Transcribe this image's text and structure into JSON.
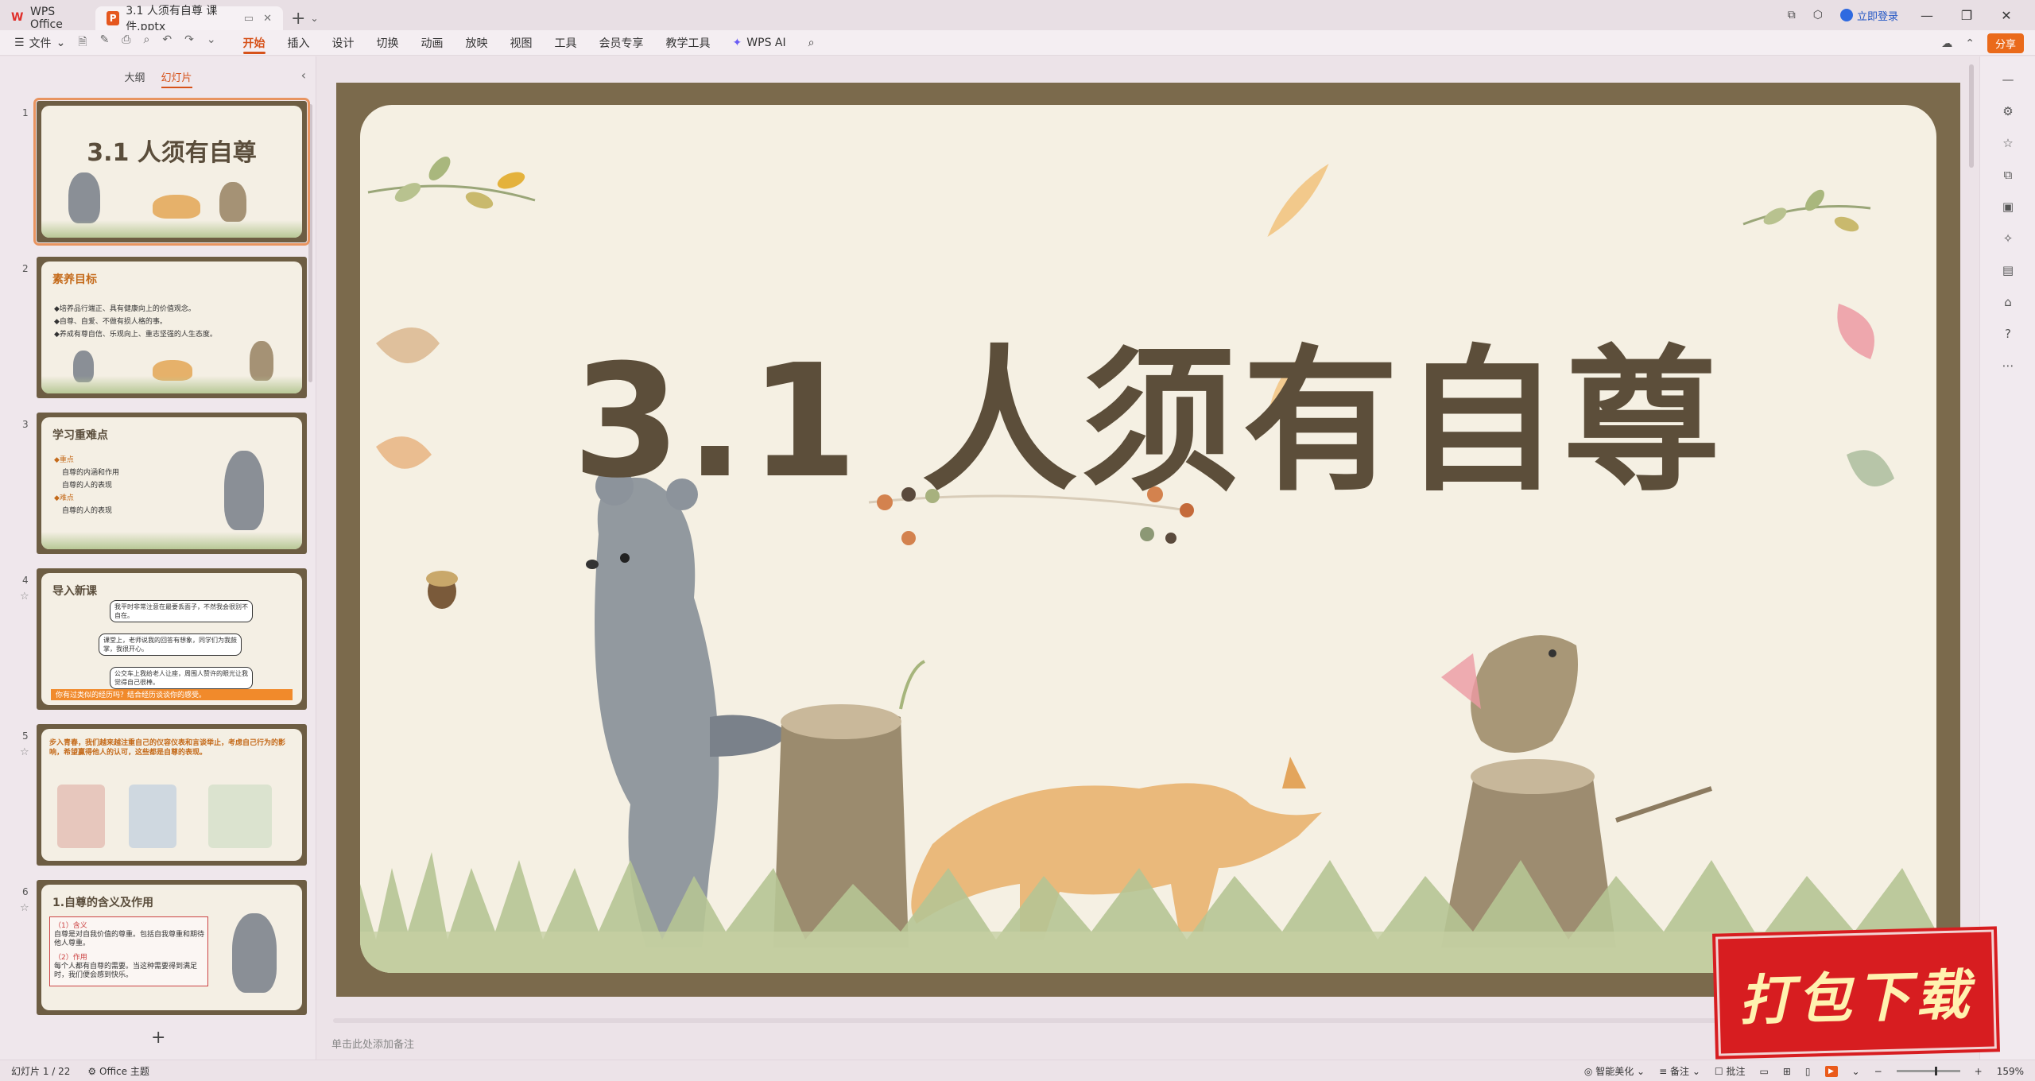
{
  "titlebar": {
    "home_tab": "WPS Office",
    "doc_tab": "3.1 人须有自尊 课件.pptx",
    "login": "立即登录"
  },
  "ribbon": {
    "file": "文件",
    "menu": [
      "开始",
      "插入",
      "设计",
      "切换",
      "动画",
      "放映",
      "视图",
      "工具",
      "会员专享",
      "教学工具"
    ],
    "active_menu": "开始",
    "wps_ai": "WPS AI",
    "share": "分享"
  },
  "left_panel": {
    "tabs": [
      "大纲",
      "幻灯片"
    ],
    "active_tab": "幻灯片",
    "slides": [
      {
        "num": "1",
        "title": "3.1 人须有自尊"
      },
      {
        "num": "2",
        "title": "素养目标",
        "lines": [
          "◆培养品行端正、具有健康向上的价值观念。",
          "◆自尊、自爱、不做有损人格的事。",
          "◆养成有尊自信、乐观向上、重志坚强的人生态度。"
        ]
      },
      {
        "num": "3",
        "title": "学习重难点",
        "lines": [
          "◆重点",
          "自尊的内涵和作用",
          "自尊的人的表现",
          "◆难点",
          "自尊的人的表现"
        ]
      },
      {
        "num": "4",
        "title": "导入新课",
        "lines": [
          "我平时非常注意在最要丢面子，不然我会很别不自在。",
          "课堂上，老师说我的回答有想象，同学们为我鼓掌，我很开心。",
          "公交车上我给老人让座，周围人赞许的眼光让我觉得自己很棒。"
        ],
        "footer": "你有过类似的经历吗？结合经历谈谈你的感受。"
      },
      {
        "num": "5",
        "title": "步入青春，我们越来越注重自己的仪容仪表和言谈举止，考虑自己行为的影响，希望赢得他人的认可，这些都是自尊的表现。"
      },
      {
        "num": "6",
        "title": "1.自尊的含义及作用",
        "lines": [
          "（1）含义",
          "自尊是对自我价值的尊重。包括自我尊重和期待他人尊重。",
          "（2）作用",
          "每个人都有自尊的需要。当这种需要得到满足时，我们便会感到快乐。"
        ]
      }
    ]
  },
  "slide": {
    "title": "3.1 人须有自尊"
  },
  "notes_placeholder": "单击此处添加备注",
  "statusbar": {
    "slide_counter": "幻灯片 1 / 22",
    "theme": "Office 主题",
    "beautify": "智能美化",
    "notes": "备注",
    "comments": "批注",
    "zoom": "159%"
  },
  "watermark": "打包下载",
  "colors": {
    "accent": "#d6521a",
    "slide_bg": "#f5f0e3",
    "frame": "#7b6a4c",
    "title": "#5c4e3a",
    "watermark": "#d71d20"
  }
}
